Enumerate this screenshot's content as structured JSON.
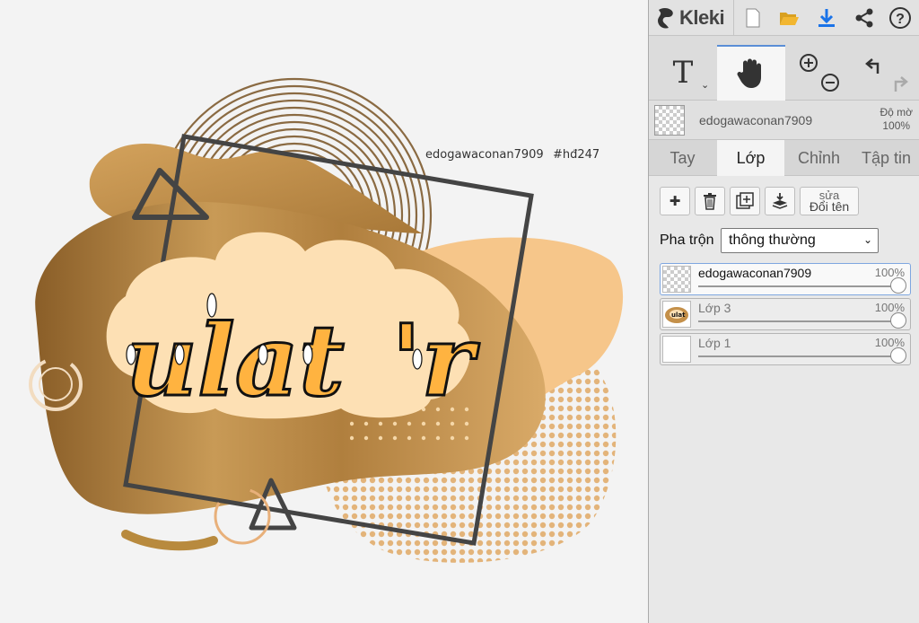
{
  "app": {
    "name": "Kleki"
  },
  "canvas": {
    "artwork_watermark": "edogawaconan7909",
    "artwork_hashtag": "#hđ247"
  },
  "toolbar": {
    "icons": [
      "new-file-icon",
      "open-folder-icon",
      "download-icon",
      "share-icon",
      "help-icon"
    ]
  },
  "tools": {
    "text_glyph": "T",
    "text_caret": "⌄",
    "selected": "hand"
  },
  "current_layer": {
    "name": "edogawaconan7909",
    "opacity_label": "Độ mờ",
    "opacity_value": "100%"
  },
  "tabs": [
    {
      "label": "Tay",
      "active": false
    },
    {
      "label": "Lớp",
      "active": true
    },
    {
      "label": "Chỉnh",
      "active": false
    },
    {
      "label": "Tập tin",
      "active": false
    }
  ],
  "layer_actions": {
    "add": "✚",
    "rename_top": "sửa",
    "rename_label": "Đổi tên"
  },
  "blend": {
    "label": "Pha trộn",
    "value": "thông thường",
    "chevron": "⌄"
  },
  "layers": [
    {
      "name": "edogawaconan7909",
      "opacity": "100%",
      "opacity_fraction": 1.0,
      "selected": true
    },
    {
      "name": "Lớp 3",
      "opacity": "100%",
      "opacity_fraction": 1.0,
      "selected": false
    },
    {
      "name": "Lớp 1",
      "opacity": "100%",
      "opacity_fraction": 1.0,
      "selected": false
    }
  ],
  "colors": {
    "accent": "#5a8ed6",
    "download_blue": "#1a73e8",
    "folder_yellow": "#f2b630",
    "art_gold_dark": "#9a6c2e",
    "art_gold_light": "#e5b878",
    "art_peach": "#f6c68a"
  }
}
